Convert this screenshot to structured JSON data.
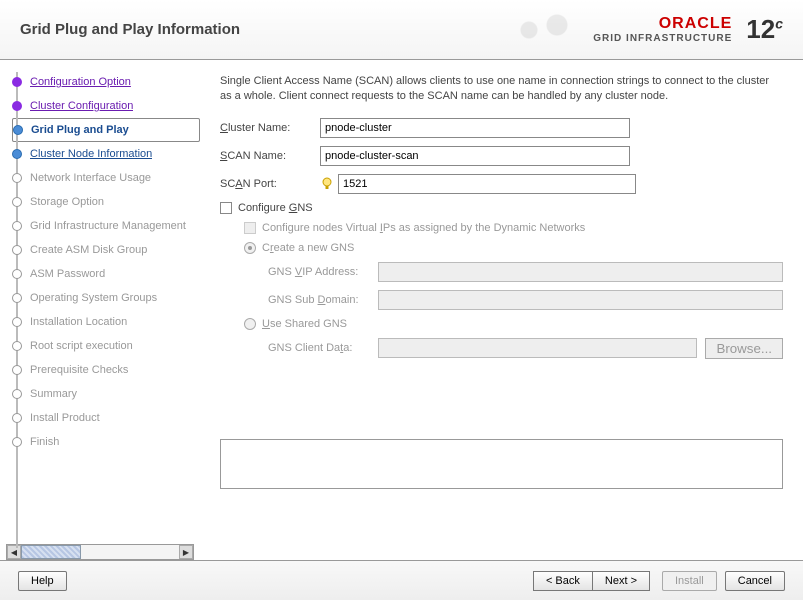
{
  "header": {
    "title": "Grid Plug and Play Information",
    "brand_top": "ORACLE",
    "brand_sub": "GRID INFRASTRUCTURE",
    "version": "12",
    "version_sup": "c"
  },
  "steps": [
    {
      "label": "Configuration Option",
      "state": "visited"
    },
    {
      "label": "Cluster Configuration",
      "state": "visited"
    },
    {
      "label": "Grid Plug and Play",
      "state": "current"
    },
    {
      "label": "Cluster Node Information",
      "state": "upcoming"
    },
    {
      "label": "Network Interface Usage",
      "state": "disabled"
    },
    {
      "label": "Storage Option",
      "state": "disabled"
    },
    {
      "label": "Grid Infrastructure Management",
      "state": "disabled"
    },
    {
      "label": "Create ASM Disk Group",
      "state": "disabled"
    },
    {
      "label": "ASM Password",
      "state": "disabled"
    },
    {
      "label": "Operating System Groups",
      "state": "disabled"
    },
    {
      "label": "Installation Location",
      "state": "disabled"
    },
    {
      "label": "Root script execution",
      "state": "disabled"
    },
    {
      "label": "Prerequisite Checks",
      "state": "disabled"
    },
    {
      "label": "Summary",
      "state": "disabled"
    },
    {
      "label": "Install Product",
      "state": "disabled"
    },
    {
      "label": "Finish",
      "state": "disabled"
    }
  ],
  "main": {
    "intro": "Single Client Access Name (SCAN) allows clients to use one name in connection strings to connect to the cluster as a whole. Client connect requests to the SCAN name can be handled by any cluster node.",
    "cluster_name_label": "Cluster Name:",
    "cluster_name_value": "pnode-cluster",
    "scan_name_label": "SCAN Name:",
    "scan_name_value": "pnode-cluster-scan",
    "scan_port_label": "SCAN Port:",
    "scan_port_value": "1521",
    "configure_gns_label": "Configure GNS",
    "configure_vip_label": "Configure nodes Virtual IPs as assigned by the Dynamic Networks",
    "create_gns_label": "Create a new GNS",
    "gns_vip_label": "GNS VIP Address:",
    "gns_sub_label": "GNS Sub Domain:",
    "use_shared_label": "Use Shared GNS",
    "gns_client_label": "GNS Client Data:",
    "browse_label": "Browse..."
  },
  "footer": {
    "help": "Help",
    "back": "< Back",
    "next": "Next >",
    "install": "Install",
    "cancel": "Cancel"
  }
}
